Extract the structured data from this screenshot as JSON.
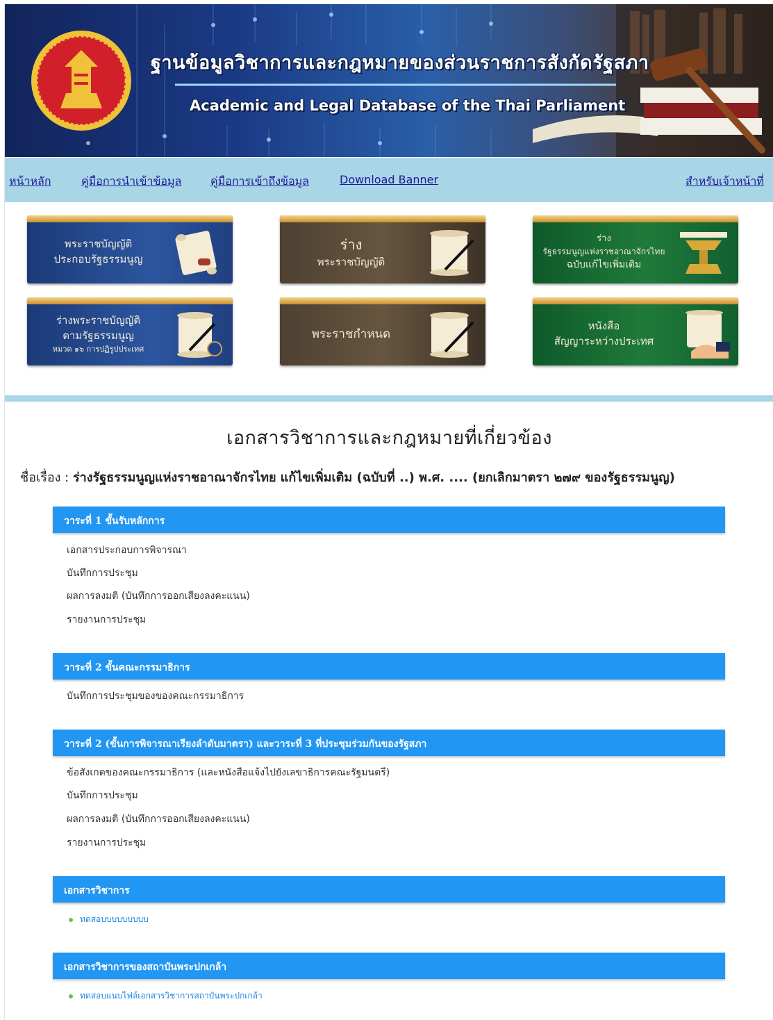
{
  "banner": {
    "title_th": "ฐานข้อมูลวิชาการและกฎหมายของส่วนราชการสังกัดรัฐสภา",
    "title_en": "Academic and Legal Database of the Thai Parliament"
  },
  "nav": {
    "home": "หน้าหลัก",
    "import_guide": "คู่มือการนำเข้าข้อมูล",
    "access_guide": "คู่มือการเข้าถึงข้อมูล",
    "download_banner": "Download Banner",
    "staff": "สำหรับเจ้าหน้าที่"
  },
  "tiles": [
    {
      "lines": [
        "พระราชบัญญัติ",
        "ประกอบรัฐธรรมนูญ"
      ],
      "color": "blue"
    },
    {
      "lines": [
        "ร่าง",
        "พระราชบัญญัติ"
      ],
      "color": "brown"
    },
    {
      "lines": [
        "ร่าง",
        "รัฐธรรมนูญแห่งราชอาณาจักรไทย",
        "ฉบับแก้ไขเพิ่มเติม"
      ],
      "color": "green"
    },
    {
      "lines": [
        "ร่างพระราชบัญญัติ",
        "ตามรัฐธรรมนูญ",
        "หมวด ๑๖ การปฏิรูปประเทศ"
      ],
      "color": "blue"
    },
    {
      "lines": [
        "พระราชกำหนด"
      ],
      "color": "brown"
    },
    {
      "lines": [
        "หนังสือ",
        "สัญญาระหว่างประเทศ"
      ],
      "color": "green"
    }
  ],
  "content": {
    "main_title": "เอกสารวิชาการและกฎหมายที่เกี่ยวข้อง",
    "subject_label": "ชื่อเรื่อง :",
    "subject_value": "ร่างรัฐธรรมนูญแห่งราชอาณาจักรไทย แก้ไขเพิ่มเติม (ฉบับที่ ..) พ.ศ. .... (ยกเลิกมาตรา ๒๗๙ ของรัฐธรรมนูญ)"
  },
  "sections": [
    {
      "title": "วาระที่ 1 ขั้นรับหลักการ",
      "items": [
        "เอกสารประกอบการพิจารณา",
        "บันทึกการประชุม",
        "ผลการลงมติ (บันทึกการออกเสียงลงคะแนน)",
        "รายงานการประชุม"
      ]
    },
    {
      "title": "วาระที่ 2 ขั้นคณะกรรมาธิการ",
      "items": [
        "บันทึกการประชุมของของคณะกรรมาธิการ"
      ]
    },
    {
      "title": "วาระที่ 2 (ขั้นการพิจารณาเรียงลำดับมาตรา) และวาระที่ 3 ที่ประชุมร่วมกันของรัฐสภา",
      "items": [
        "ข้อสังเกตของคณะกรรมาธิการ (และหนังสือแจ้งไปยังเลขาธิการคณะรัฐมนตรี)",
        "บันทึกการประชุม",
        "ผลการลงมติ (บันทึกการออกเสียงลงคะแนน)",
        "รายงานการประชุม"
      ]
    },
    {
      "title": "เอกสารวิชาการ",
      "links": [
        "ทดสอบบบบบบบบบ"
      ]
    },
    {
      "title": "เอกสารวิชาการของสถาบันพระปกเกล้า",
      "links": [
        "ทดสอบแนบไฟล์เอกสารวิชาการสถาบันพระปกเกล้า"
      ]
    }
  ],
  "colors": {
    "nav_bg": "#a9d6e6",
    "section_bg": "#2196f3",
    "link": "#1a1a9a",
    "bullet": "#6cc24a"
  }
}
